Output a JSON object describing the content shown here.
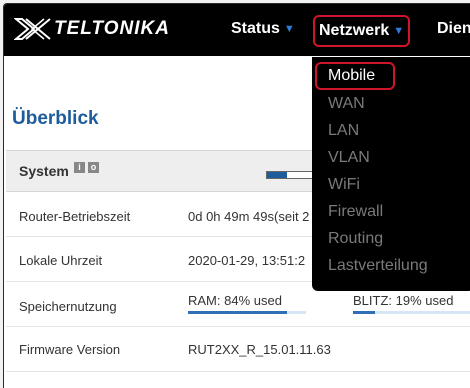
{
  "brand": {
    "name": "TELTONIKA"
  },
  "nav": {
    "items": [
      {
        "label": "Status"
      },
      {
        "label": "Netzwerk"
      },
      {
        "label": "Dien"
      }
    ]
  },
  "page": {
    "title": "Überblick"
  },
  "system": {
    "label": "System",
    "info_icon": "i",
    "settings_icon": "o"
  },
  "rows": [
    {
      "label": "Router-Betriebszeit",
      "value": "0d 0h 49m 49s(seit 2"
    },
    {
      "label": "Lokale Uhrzeit",
      "value": "2020-01-29, 13:51:2"
    },
    {
      "label": "Speichernutzung",
      "ram": "RAM: 84% used",
      "ram_fraction": 0.84,
      "flash": "BLITZ: 19% used",
      "flash_fraction": 0.19
    },
    {
      "label": "Firmware Version",
      "value": "RUT2XX_R_15.01.11.63"
    }
  ],
  "dropdown": {
    "items": [
      {
        "label": "Mobile"
      },
      {
        "label": "WAN"
      },
      {
        "label": "LAN"
      },
      {
        "label": "VLAN"
      },
      {
        "label": "WiFi"
      },
      {
        "label": "Firewall"
      },
      {
        "label": "Routing"
      },
      {
        "label": "Lastverteilung"
      }
    ]
  },
  "colors": {
    "accent_blue": "#1f5c9c",
    "highlight_red": "#d0142a",
    "nav_caret": "#2f7bd6"
  }
}
